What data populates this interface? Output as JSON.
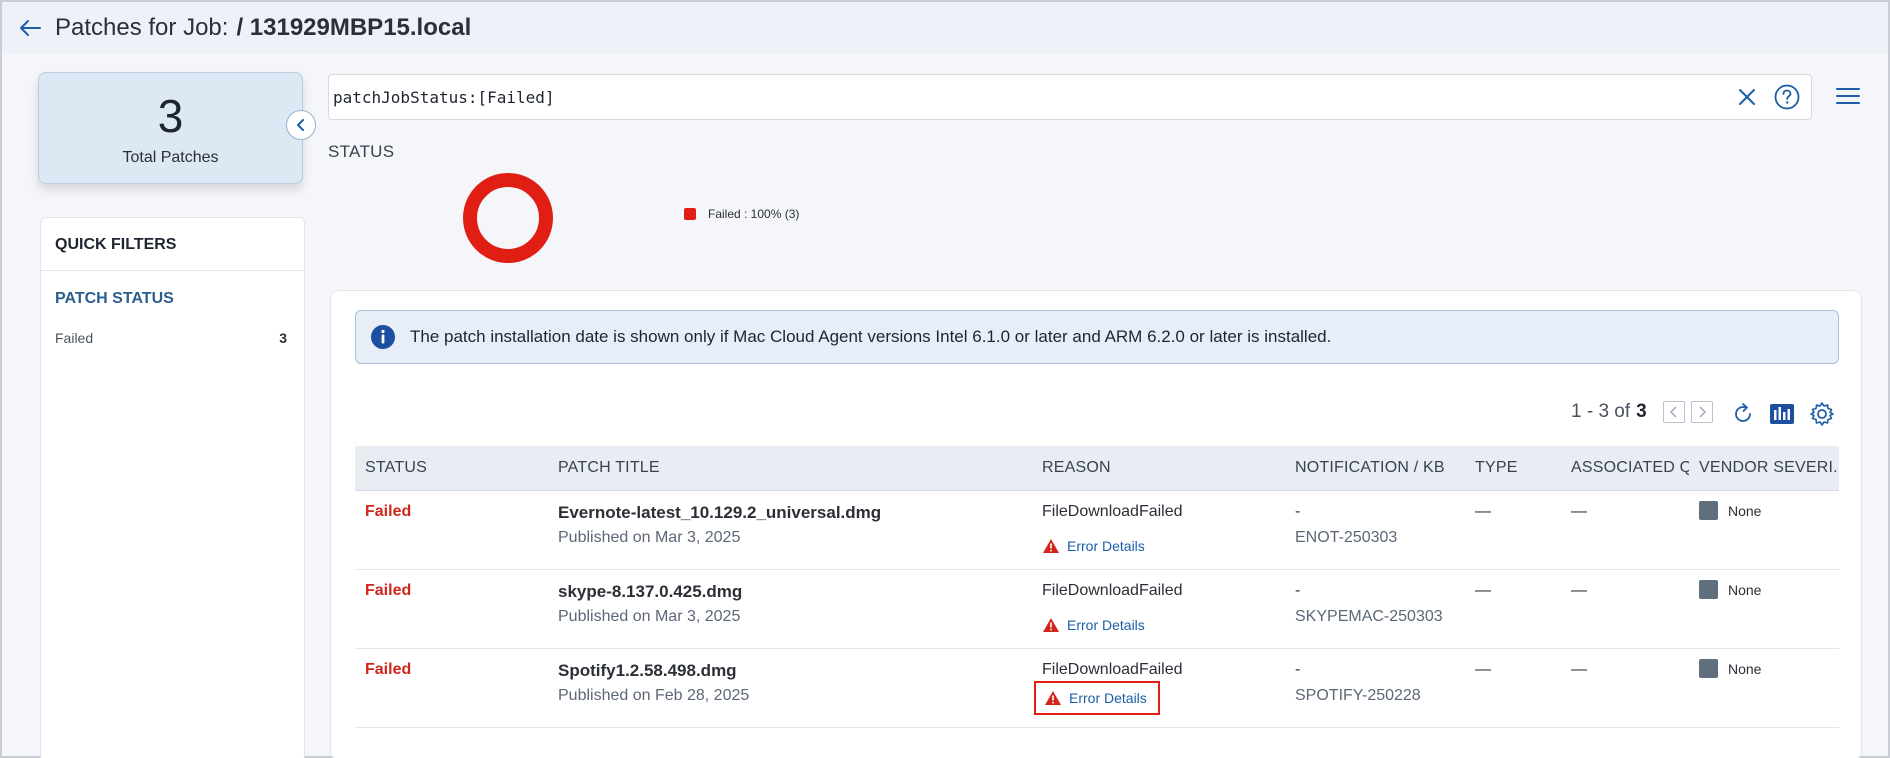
{
  "header": {
    "title_prefix": "Patches for Job:",
    "job_name": "/ 131929MBP15.local"
  },
  "summary": {
    "total_count": "3",
    "total_label": "Total Patches"
  },
  "quick_filters": {
    "title": "QUICK FILTERS",
    "section_label": "PATCH STATUS",
    "items": [
      {
        "label": "Failed",
        "count": "3"
      }
    ]
  },
  "search": {
    "query": "patchJobStatus:[Failed]"
  },
  "status_chart": {
    "heading": "STATUS",
    "legend_label": "Failed : 100% (3)",
    "failed_color": "#e01e14"
  },
  "chart_data": {
    "type": "pie",
    "categories": [
      "Failed"
    ],
    "values": [
      100
    ],
    "counts": [
      3
    ]
  },
  "info_banner": {
    "text": "The patch installation date is shown only if Mac Cloud Agent versions Intel 6.1.0 or later and ARM 6.2.0 or later is installed."
  },
  "pager": {
    "range": "1 - 3 of",
    "total": "3"
  },
  "table": {
    "columns": [
      "STATUS",
      "PATCH TITLE",
      "REASON",
      "NOTIFICATION / KB",
      "TYPE",
      "ASSOCIATED Q...",
      "VENDOR SEVERI..."
    ],
    "rows": [
      {
        "status": "Failed",
        "title": "Evernote-latest_10.129.2_universal.dmg",
        "published": "Published on Mar 3, 2025",
        "reason": "FileDownloadFailed",
        "error_link": "Error Details",
        "notification": "-",
        "kb": "ENOT-250303",
        "type": "—",
        "associated": "—",
        "vendor_severity": "None"
      },
      {
        "status": "Failed",
        "title": "skype-8.137.0.425.dmg",
        "published": "Published on Mar 3, 2025",
        "reason": "FileDownloadFailed",
        "error_link": "Error Details",
        "notification": "-",
        "kb": "SKYPEMAC-250303",
        "type": "—",
        "associated": "—",
        "vendor_severity": "None"
      },
      {
        "status": "Failed",
        "title": "Spotify1.2.58.498.dmg",
        "published": "Published on Feb 28, 2025",
        "reason": "FileDownloadFailed",
        "error_link": "Error Details",
        "notification": "-",
        "kb": "SPOTIFY-250228",
        "type": "—",
        "associated": "—",
        "vendor_severity": "None"
      }
    ]
  }
}
